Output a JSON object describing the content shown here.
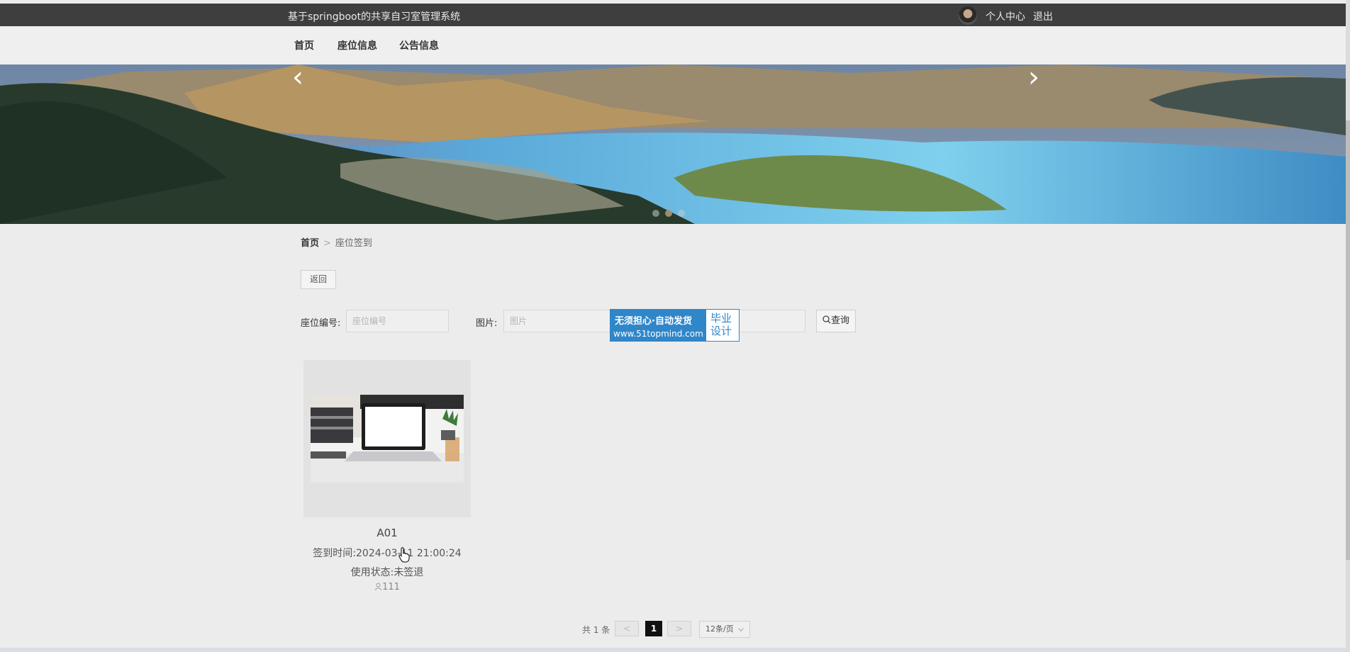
{
  "header": {
    "site_title": "基于springboot的共享自习室管理系统",
    "user_center": "个人中心",
    "logout": "退出"
  },
  "nav": {
    "items": [
      "首页",
      "座位信息",
      "公告信息"
    ]
  },
  "banner": {
    "prev_icon": "‹",
    "next_icon": "›",
    "slide_count": 3,
    "active_slide": 2
  },
  "breadcrumb": {
    "home": "首页",
    "separator": ">",
    "current": "座位签到"
  },
  "back_button": "返回",
  "search": {
    "seat_no_label": "座位编号:",
    "seat_no_placeholder": "座位编号",
    "image_label": "图片:",
    "image_placeholder": "图片",
    "query_icon": "search-icon",
    "query_label": "查询"
  },
  "watermark": {
    "line1": "无须担心·自动发货",
    "line2": "www.51topmind.com",
    "side_line1": "毕业",
    "side_line2": "设计"
  },
  "records": [
    {
      "seat": "A01",
      "checkin_time": "签到时间:2024-03-11 21:00:24",
      "status": "使用状态:未签退",
      "user": "111"
    }
  ],
  "pagination": {
    "total": "共 1 条",
    "prev": "<",
    "current_page": "1",
    "next": ">",
    "page_size": "12条/页"
  },
  "colors": {
    "topbar": "#3e3e3e",
    "watermark_blue": "#2f86c9",
    "active_page": "#111111"
  }
}
